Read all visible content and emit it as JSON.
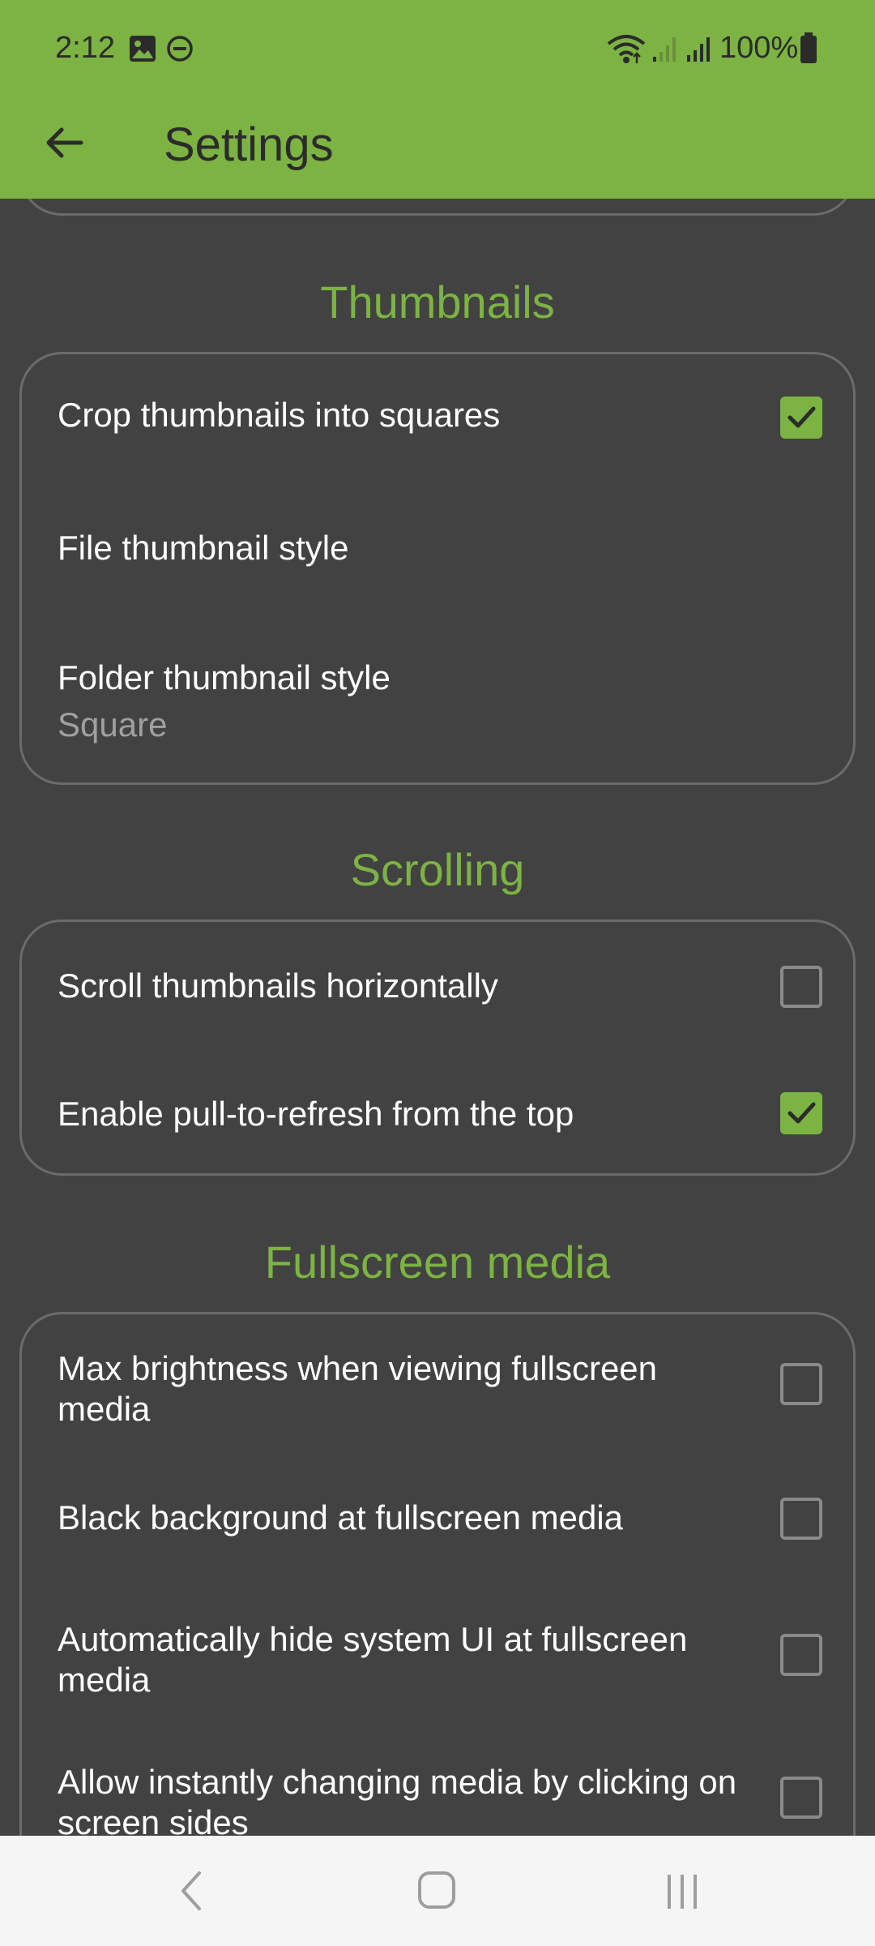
{
  "status_bar": {
    "time": "2:12",
    "battery": "100%",
    "icons": [
      "image-icon",
      "dnd-icon",
      "wifi-icon",
      "signal-icon",
      "signal-icon-2",
      "battery-icon"
    ]
  },
  "app_bar": {
    "title": "Settings",
    "back_icon": "back-arrow-icon"
  },
  "sections": {
    "thumbnails": {
      "title": "Thumbnails",
      "items": [
        {
          "label": "Crop thumbnails into squares",
          "checked": true
        },
        {
          "label": "File thumbnail style"
        },
        {
          "label": "Folder thumbnail style",
          "value": "Square"
        }
      ]
    },
    "scrolling": {
      "title": "Scrolling",
      "items": [
        {
          "label": "Scroll thumbnails horizontally",
          "checked": false
        },
        {
          "label": "Enable pull-to-refresh from the top",
          "checked": true
        }
      ]
    },
    "fullscreen": {
      "title": "Fullscreen media",
      "items": [
        {
          "label": "Max brightness when viewing fullscreen media",
          "checked": false
        },
        {
          "label": "Black background at fullscreen media",
          "checked": false
        },
        {
          "label": "Automatically hide system UI at fullscreen media",
          "checked": false
        },
        {
          "label": "Allow instantly changing media by clicking on screen sides",
          "checked": false
        }
      ]
    }
  },
  "nav_bar": {
    "back": "nav-back-icon",
    "home": "nav-home-icon",
    "recents": "nav-recents-icon"
  },
  "colors": {
    "accent": "#7cb342",
    "background": "#424242"
  }
}
